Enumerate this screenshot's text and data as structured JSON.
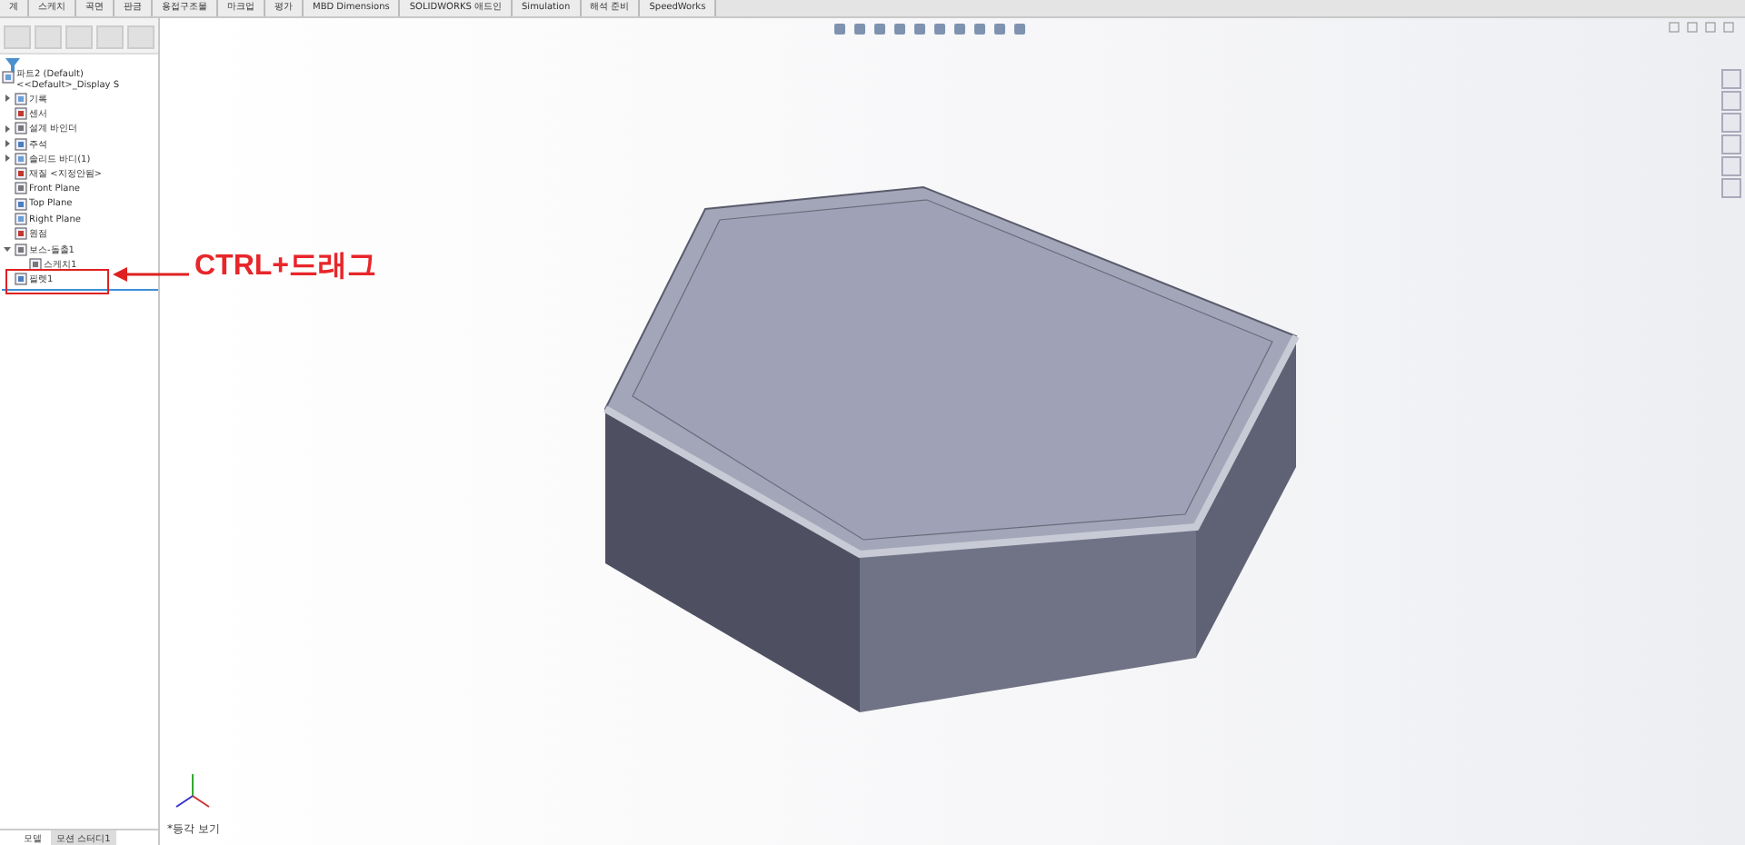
{
  "command_tabs": [
    "계",
    "스케치",
    "곡면",
    "판금",
    "용접구조물",
    "마크업",
    "평가",
    "MBD Dimensions",
    "SOLIDWORKS 애드인",
    "Simulation",
    "해석 준비",
    "SpeedWorks"
  ],
  "feature_tree": {
    "root": "파트2 (Default) <<Default>_Display S",
    "items": [
      {
        "label": "기록",
        "expanded": false
      },
      {
        "label": "센서"
      },
      {
        "label": "설계 바인더",
        "expanded": false
      },
      {
        "label": "주석",
        "expanded": false
      },
      {
        "label": "솔리드 바디(1)",
        "expanded": false
      },
      {
        "label": "재질 <지정안됨>"
      },
      {
        "label": "Front Plane"
      },
      {
        "label": "Top Plane"
      },
      {
        "label": "Right Plane"
      },
      {
        "label": "원점"
      },
      {
        "label": "보스-돌출1",
        "expanded": true,
        "children": [
          {
            "label": "스케치1"
          }
        ]
      },
      {
        "label": "필렛1"
      }
    ]
  },
  "annotation": {
    "text": "CTRL+드래그"
  },
  "view_label": "*등각 보기",
  "bottom_tabs": [
    {
      "label": "모델",
      "selected": true
    },
    {
      "label": "모션 스터디1",
      "selected": false
    }
  ]
}
